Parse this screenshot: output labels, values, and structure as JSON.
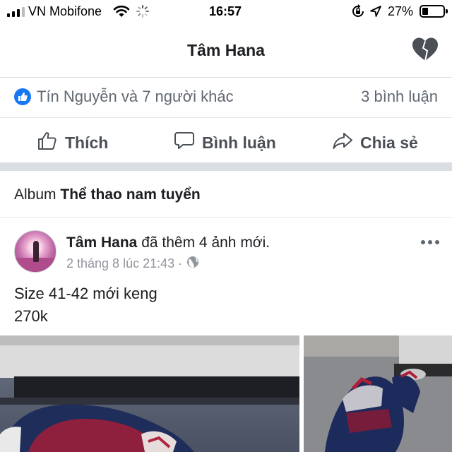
{
  "status_bar": {
    "carrier": "VN Mobifone",
    "time": "16:57",
    "battery_percent": "27%",
    "battery_level": 0.27
  },
  "header": {
    "title": "Tâm Hana",
    "icons": [
      "heart-icon"
    ]
  },
  "reactions": {
    "text": "Tín Nguyễn và 7 người khác",
    "comments": "3 bình luận"
  },
  "actions": {
    "like": "Thích",
    "comment": "Bình luận",
    "share": "Chia sẻ"
  },
  "album": {
    "prefix": "Album",
    "name": "Thể thao nam tuyển"
  },
  "post": {
    "author": "Tâm Hana",
    "action": "đã thêm 4 ảnh mới.",
    "time": "2 tháng 8 lúc 21:43 ·",
    "body_line1": "Size 41-42 mới keng",
    "body_line2": "270k"
  },
  "colors": {
    "accent_blue": "#1877f2",
    "text_primary": "#1c1e21",
    "text_secondary": "#606770",
    "divider": "#dadde1"
  }
}
